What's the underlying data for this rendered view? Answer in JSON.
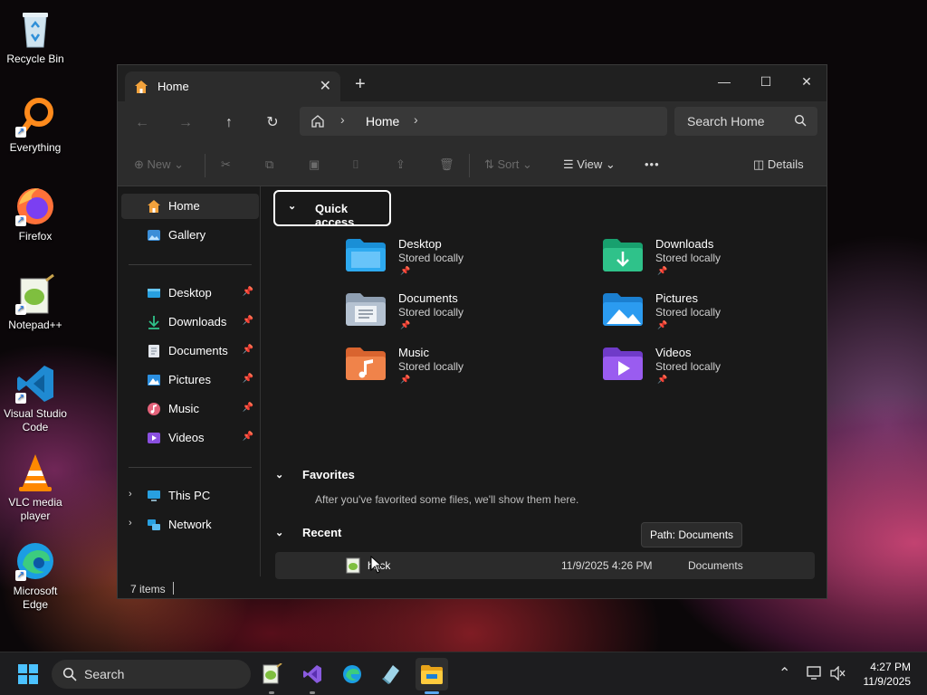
{
  "desktop": {
    "icons": [
      {
        "label": "Recycle Bin"
      },
      {
        "label": "Everything"
      },
      {
        "label": "Firefox"
      },
      {
        "label": "Notepad++"
      },
      {
        "label": "Visual Studio Code"
      },
      {
        "label": "VLC media player"
      },
      {
        "label": "Microsoft Edge"
      }
    ]
  },
  "window": {
    "tab_title": "Home",
    "tab_close": "✕",
    "new_tab": "+",
    "controls": {
      "minimize": "—",
      "maximize": "☐",
      "close": "✕"
    },
    "address": {
      "breadcrumb": "Home"
    },
    "search": {
      "placeholder": "Search Home"
    },
    "commands": {
      "new": "New",
      "sort": "Sort",
      "view": "View",
      "more": "•••",
      "details": "Details"
    },
    "nav": {
      "home": "Home",
      "gallery": "Gallery",
      "pinned": [
        {
          "label": "Desktop"
        },
        {
          "label": "Downloads"
        },
        {
          "label": "Documents"
        },
        {
          "label": "Pictures"
        },
        {
          "label": "Music"
        },
        {
          "label": "Videos"
        }
      ],
      "this_pc": "This PC",
      "network": "Network"
    },
    "quick_access": {
      "title": "Quick access",
      "items": [
        {
          "name": "Desktop",
          "status": "Stored locally"
        },
        {
          "name": "Downloads",
          "status": "Stored locally"
        },
        {
          "name": "Documents",
          "status": "Stored locally"
        },
        {
          "name": "Pictures",
          "status": "Stored locally"
        },
        {
          "name": "Music",
          "status": "Stored locally"
        },
        {
          "name": "Videos",
          "status": "Stored locally"
        }
      ]
    },
    "favorites": {
      "title": "Favorites",
      "empty_message": "After you've favorited some files, we'll show them here."
    },
    "recent": {
      "title": "Recent",
      "rows": [
        {
          "name": "hack",
          "date": "11/9/2025 4:26 PM",
          "location": "Documents"
        }
      ]
    },
    "tooltip": "Path: Documents",
    "status": {
      "items": "7 items"
    }
  },
  "taskbar": {
    "search_placeholder": "Search",
    "time": "4:27 PM",
    "date": "11/9/2025"
  },
  "colors": {
    "accent": "#5aa7f0",
    "window_bg": "#191919",
    "toolbar_bg": "#2c2c2c"
  }
}
